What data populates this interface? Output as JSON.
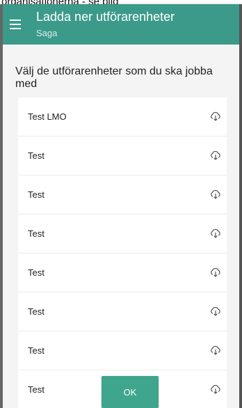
{
  "caption": "organisationerna - se bild",
  "appbar": {
    "title": "Ladda ner utförarenheter",
    "subtitle": "Saga"
  },
  "content": {
    "heading": "Välj de utförarenheter som du ska jobba med",
    "units": [
      {
        "label": "Test LMO"
      },
      {
        "label": "Test"
      },
      {
        "label": "Test"
      },
      {
        "label": "Test"
      },
      {
        "label": "Test"
      },
      {
        "label": "Test"
      },
      {
        "label": "Test"
      },
      {
        "label": "Test"
      }
    ]
  },
  "ok_label": "OK",
  "colors": {
    "appbar": "#3b9a8a",
    "button": "#3fa58c",
    "background": "#f4f4f4"
  },
  "icons": {
    "menu": "menu-icon",
    "download": "cloud-download-icon"
  }
}
